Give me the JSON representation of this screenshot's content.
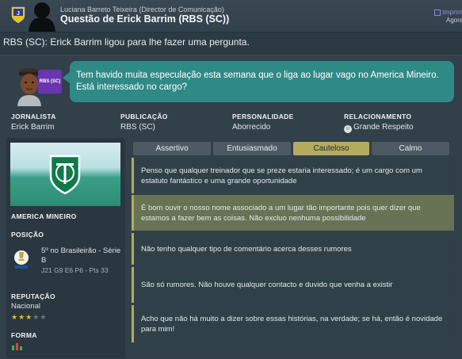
{
  "header": {
    "subtitle": "Luciana Barreto Teixeira  (Director de Comunicação)",
    "title": "Questão de Erick Barrim (RBS (SC))",
    "print_label": "Imprimir",
    "time_label": "Agora"
  },
  "intro": "RBS (SC): Erick Barrim ligou para lhe fazer uma pergunta.",
  "journalist": {
    "outlet_badge": "RBS (SC)",
    "question": "Tem havido muita especulação esta semana que o liga ao lugar vago no America Mineiro. Está interessado no cargo?",
    "fields": [
      {
        "label": "JORNALISTA",
        "value": "Erick Barrim"
      },
      {
        "label": "PUBLICAÇÃO",
        "value": "RBS (SC)"
      },
      {
        "label": "PERSONALIDADE",
        "value": "Aborrecido"
      },
      {
        "label": "RELACIONAMENTO",
        "value": "Grande Respeito"
      }
    ]
  },
  "club": {
    "name": "AMERICA MINEIRO",
    "position_label": "POSIÇÃO",
    "position_text": "5º no Brasileirão - Série B",
    "position_stats": "J21 G9 E6 P6 - Pts 33",
    "reputation_label": "REPUTAÇÃO",
    "reputation_value": "Nacional",
    "reputation_stars": 3,
    "reputation_max": 5,
    "form_label": "FORMA",
    "star_color": "#e2b640",
    "star_empty_color": "#6b7780"
  },
  "tones": [
    {
      "label": "Assertivo",
      "active": false
    },
    {
      "label": "Entusiasmado",
      "active": false
    },
    {
      "label": "Cauteloso",
      "active": true
    },
    {
      "label": "Calmo",
      "active": false
    }
  ],
  "responses": [
    "Penso que qualquer treinador que se preze estaria interessado; é um cargo com um estatuto fantástico e uma grande oportunidade",
    "É bom ouvir o nosso nome associado a um lugar tão importante pois quer dizer que estamos a fazer bem as coisas. Não excluo nenhuma possibilidade",
    "Não tenho qualquer tipo de comentário acerca desses rumores",
    "São só rumores. Não houve qualquer contacto e duvido que venha a existir",
    "Acho que não há muito a dizer sobre essas histórias, na verdade; se há, então é novidade para mim!"
  ],
  "colors": {
    "accent": "#b5ab5e",
    "bubble": "#2f8a86",
    "outlet": "#6b34b0",
    "highlight": "#687254"
  }
}
